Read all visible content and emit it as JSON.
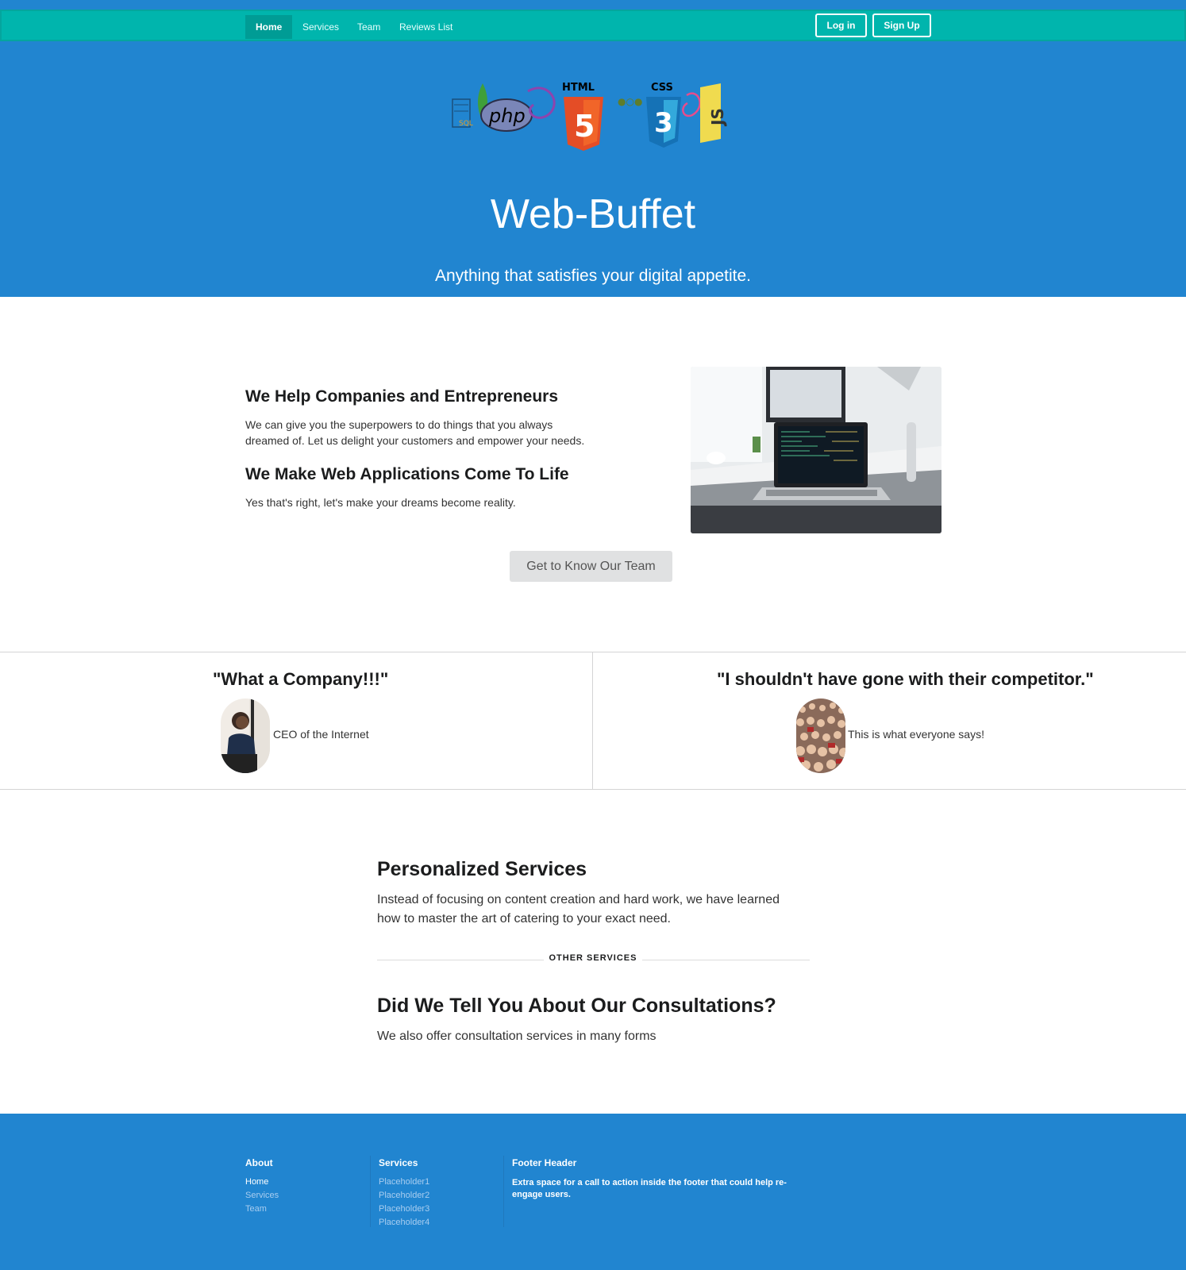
{
  "colors": {
    "hero_bg": "#2185d0",
    "topbar_bg": "#00b5ad",
    "topbar_active": "#009c95",
    "footer_bg": "#2185d0",
    "button_grey": "#e0e1e2"
  },
  "nav": {
    "items": [
      {
        "label": "Home",
        "active": true
      },
      {
        "label": "Services"
      },
      {
        "label": "Team"
      },
      {
        "label": "Reviews List"
      }
    ],
    "login_label": "Log in",
    "signup_label": "Sign Up"
  },
  "hero": {
    "logo_labels": [
      "php",
      "HTML",
      "5",
      "CSS",
      "3",
      "JS"
    ],
    "title": "Web-Buffet",
    "subtitle": "Anything that satisfies your digital appetite."
  },
  "intro": {
    "heading1": "We Help Companies and Entrepreneurs",
    "text1_line1": "We can give you the superpowers to do things that you always",
    "text1_line2": "dreamed of. Let us delight your customers and empower your needs.",
    "heading2": "We Make Web Applications Come To Life",
    "text2": "Yes that's right, let's make your dreams become reality.",
    "cta_label": "Get to Know Our Team"
  },
  "testimonials": [
    {
      "quote": "\"What a Company!!!\"",
      "attribution": "CEO of the Internet"
    },
    {
      "quote": "\"I shouldn't have gone with their competitor.\"",
      "attribution": "This is what everyone says!"
    }
  ],
  "services": {
    "heading1": "Personalized Services",
    "text1_line1": "Instead of focusing on content creation and hard work, we have learned",
    "text1_line2": "how to master the art of catering to your exact need.",
    "divider_label": "OTHER SERVICES",
    "heading2": "Did We Tell You About Our Consultations?",
    "text2": "We also offer consultation services in many forms"
  },
  "footer": {
    "about": {
      "heading": "About",
      "links": [
        "Home",
        "Services",
        "Team"
      ]
    },
    "services": {
      "heading": "Services",
      "links": [
        "Placeholder1",
        "Placeholder2",
        "Placeholder3",
        "Placeholder4"
      ]
    },
    "cta": {
      "heading": "Footer Header",
      "text": "Extra space for a call to action inside the footer that could help re-engage users."
    }
  }
}
